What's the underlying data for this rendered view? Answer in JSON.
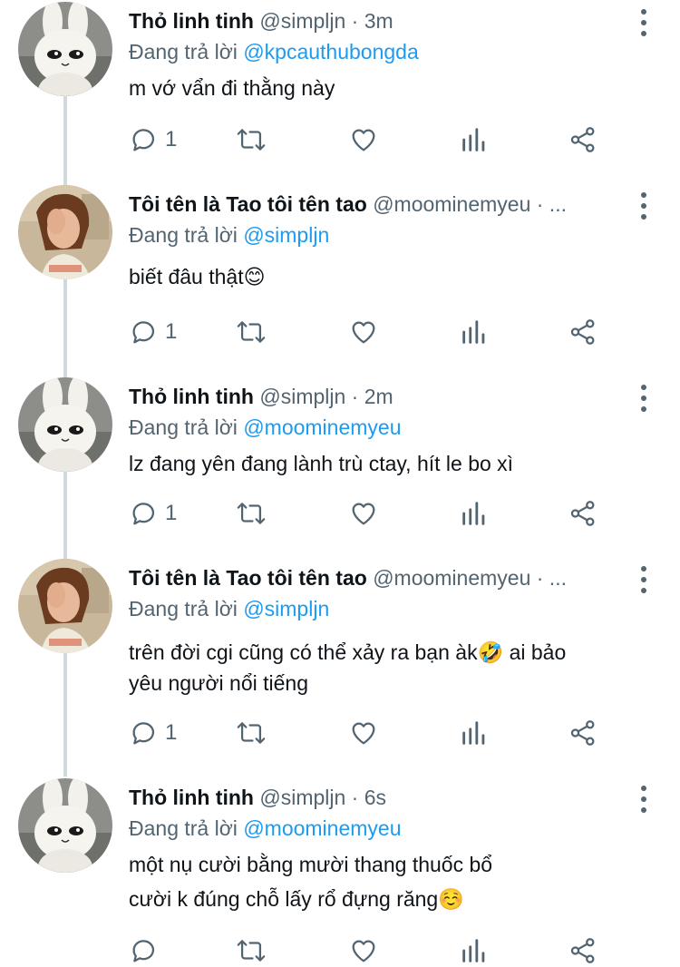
{
  "reply_prefix": "Đang trả lời",
  "tweets": [
    {
      "name": "Thỏ linh tinh",
      "handle": "@simpljn · 3m",
      "reply_to": "@kpcauthubongda",
      "lines": [
        "m vớ vẩn đi thằng này"
      ],
      "reply_count": "1",
      "avatar": "bunny-avatar"
    },
    {
      "name": "Tôi tên là Tao tôi tên tao",
      "handle": "@moominemyeu · ...",
      "reply_to": "@simpljn",
      "lines": [
        "biết đâu thật😊"
      ],
      "reply_count": "1",
      "avatar": "woman-avatar"
    },
    {
      "name": "Thỏ linh tinh",
      "handle": "@simpljn · 2m",
      "reply_to": "@moominemyeu",
      "lines": [
        "lz đang yên đang lành trù ctay, hít le bo xì"
      ],
      "reply_count": "1",
      "avatar": "bunny-avatar"
    },
    {
      "name": "Tôi tên là Tao tôi tên tao",
      "handle": "@moominemyeu · ...",
      "reply_to": "@simpljn",
      "lines": [
        "trên đời cgi cũng có thể xảy ra bạn àk🤣 ai bảo",
        "yêu người nổi tiếng"
      ],
      "reply_count": "1",
      "avatar": "woman-avatar"
    },
    {
      "name": "Thỏ linh tinh",
      "handle": "@simpljn · 6s",
      "reply_to": "@moominemyeu",
      "lines": [
        "một nụ cười bằng mười thang thuốc bổ",
        "cười k đúng chỗ lấy rổ đựng răng☺️"
      ],
      "reply_count": "",
      "avatar": "bunny-avatar"
    }
  ],
  "icons": {
    "reply": "reply-icon",
    "retweet": "retweet-icon",
    "like": "heart-icon",
    "analytics": "analytics-icon",
    "share": "share-icon",
    "more": "more-icon"
  },
  "colors": {
    "link": "#1d9bf0",
    "secondary": "#536471",
    "thread_line": "#cfd9de"
  }
}
